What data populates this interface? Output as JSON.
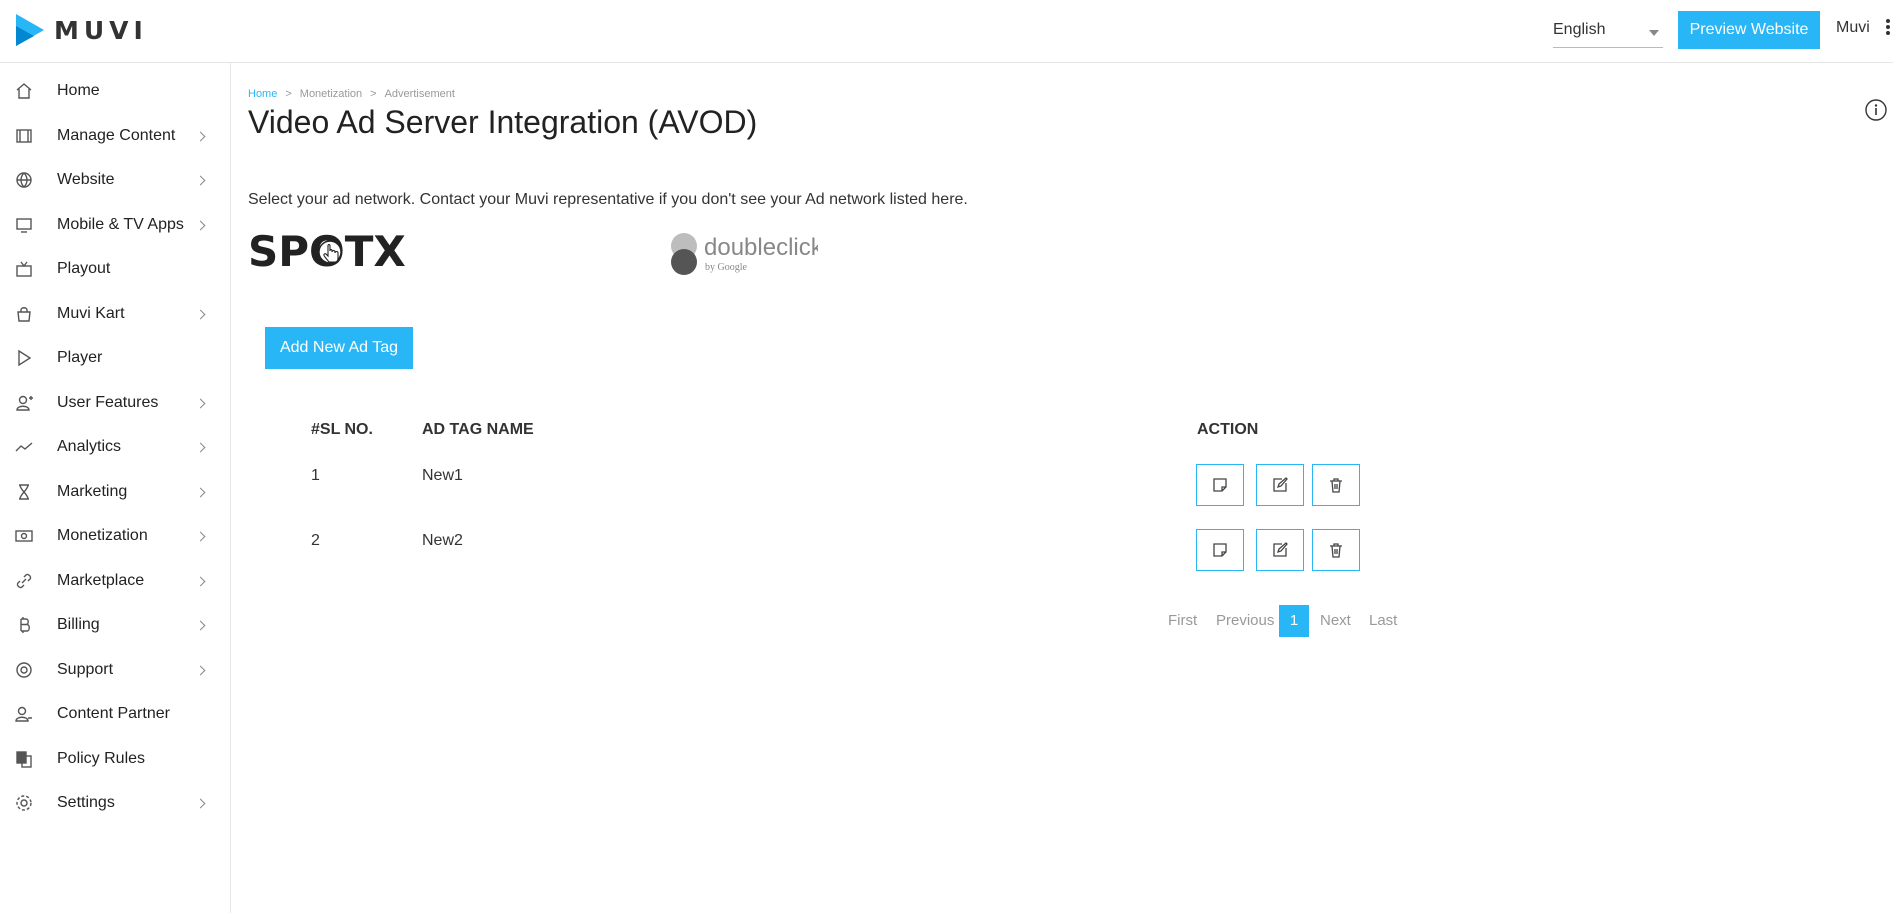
{
  "header": {
    "brand": "MUVI",
    "language": "English",
    "preview_label": "Preview Website",
    "user": "Muvi"
  },
  "sidebar": {
    "items": [
      {
        "label": "Home",
        "icon": "home-icon",
        "has_children": false
      },
      {
        "label": "Manage Content",
        "icon": "film-icon",
        "has_children": true
      },
      {
        "label": "Website",
        "icon": "globe-icon",
        "has_children": true
      },
      {
        "label": "Mobile & TV Apps",
        "icon": "monitor-icon",
        "has_children": true
      },
      {
        "label": "Playout",
        "icon": "tv-icon",
        "has_children": false
      },
      {
        "label": "Muvi Kart",
        "icon": "shopping-bag-icon",
        "has_children": true
      },
      {
        "label": "Player",
        "icon": "play-icon",
        "has_children": false
      },
      {
        "label": "User Features",
        "icon": "user-add-icon",
        "has_children": true
      },
      {
        "label": "Analytics",
        "icon": "trend-icon",
        "has_children": true
      },
      {
        "label": "Marketing",
        "icon": "hourglass-icon",
        "has_children": true
      },
      {
        "label": "Monetization",
        "icon": "money-icon",
        "has_children": true
      },
      {
        "label": "Marketplace",
        "icon": "link-icon",
        "has_children": true
      },
      {
        "label": "Billing",
        "icon": "bitcoin-icon",
        "has_children": true
      },
      {
        "label": "Support",
        "icon": "lifebuoy-icon",
        "has_children": true
      },
      {
        "label": "Content Partner",
        "icon": "partner-icon",
        "has_children": false
      },
      {
        "label": "Policy Rules",
        "icon": "copy-icon",
        "has_children": false
      },
      {
        "label": "Settings",
        "icon": "gear-icon",
        "has_children": true
      }
    ]
  },
  "breadcrumb": {
    "home": "Home",
    "level2": "Monetization",
    "level3": "Advertisement",
    "separator": ">"
  },
  "page": {
    "title": "Video Ad Server Integration (AVOD)",
    "instruction": "Select your ad network. Contact your Muvi representative if you don't see your Ad network listed here.",
    "networks": {
      "spotx": "SPOTX",
      "doubleclick": "doubleclick",
      "doubleclick_sub": "by Google"
    },
    "add_button": "Add New Ad Tag"
  },
  "table": {
    "columns": [
      "#SL NO.",
      "AD TAG NAME",
      "ACTION"
    ],
    "rows": [
      {
        "sl": "1",
        "name": "New1"
      },
      {
        "sl": "2",
        "name": "New2"
      }
    ]
  },
  "pagination": {
    "first": "First",
    "previous": "Previous",
    "current": "1",
    "next": "Next",
    "last": "Last"
  },
  "colors": {
    "accent": "#29b6f6"
  }
}
